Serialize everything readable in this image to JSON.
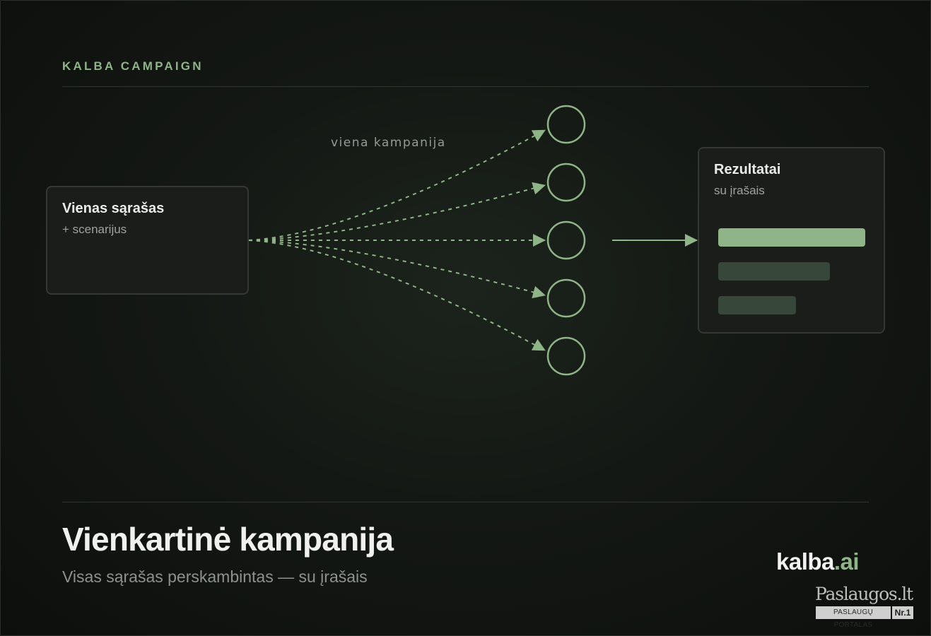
{
  "header": {
    "eyebrow": "KALBA CAMPAIGN"
  },
  "source_card": {
    "title": "Vienas sąrašas",
    "subtitle": "+ scenarijus"
  },
  "flow": {
    "label": "viena kampanija",
    "nodes": 5
  },
  "results_card": {
    "title": "Rezultatai",
    "subtitle": "su įrašais",
    "bars": [
      {
        "level": 1.0,
        "color": "#8fb487"
      },
      {
        "level": 0.76,
        "color": "#37473a"
      },
      {
        "level": 0.53,
        "color": "#37473a"
      }
    ]
  },
  "footer": {
    "title": "Vienkartinė kampanija",
    "subtitle": "Visas sąrašas perskambintas — su įrašais"
  },
  "logo": {
    "brand": "kalba",
    "tld": ".ai"
  },
  "badge": {
    "name": "Paslaugos.lt",
    "tagline": "PASLAUGŲ PORTALAS",
    "rank": "Nr.1"
  },
  "colors": {
    "accent": "#8fb487",
    "accent_dark": "#37473a",
    "background": "#141814"
  }
}
